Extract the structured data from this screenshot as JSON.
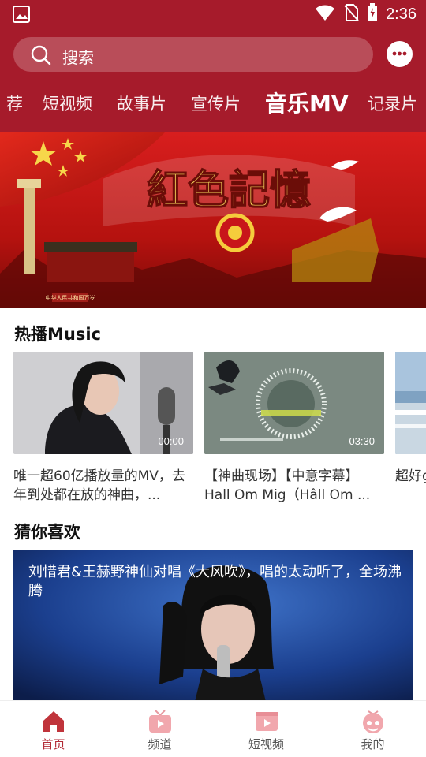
{
  "status_bar": {
    "time": "2:36",
    "icons": [
      "gallery-icon",
      "wifi-icon",
      "no-sim-icon",
      "battery-icon"
    ]
  },
  "header": {
    "search_placeholder": "搜索",
    "chat_icon": "chat-bubble-icon",
    "brand_color": "#a61b2b"
  },
  "tabs": [
    {
      "label": "荐"
    },
    {
      "label": "短视频"
    },
    {
      "label": "故事片"
    },
    {
      "label": "宣传片"
    },
    {
      "label": "音乐MV",
      "active": true
    },
    {
      "label": "记录片"
    }
  ],
  "banner": {
    "title": "紅色記憶",
    "plaque_text": "中华人民共和国万岁"
  },
  "hot_music": {
    "heading": "热播Music",
    "items": [
      {
        "duration": "00:00",
        "title": "唯一超60亿播放量的MV，去年到处都在放的神曲，..."
      },
      {
        "duration": "03:30",
        "title": "【神曲现场】【中意字幕】Hall Om Mig（Hâll Om ..."
      },
      {
        "duration": "",
        "title": "超好girl"
      }
    ]
  },
  "guess_like": {
    "heading": "猜你喜欢",
    "items": [
      {
        "title": "刘惜君&王赫野神仙对唱《大风吹》，唱的太动听了，全场沸腾"
      }
    ]
  },
  "bottom_nav": [
    {
      "label": "首页",
      "icon": "home-icon",
      "active": true
    },
    {
      "label": "频道",
      "icon": "tv-channel-icon"
    },
    {
      "label": "短视频",
      "icon": "video-play-icon"
    },
    {
      "label": "我的",
      "icon": "profile-icon"
    }
  ],
  "colors": {
    "accent": "#a61b2b",
    "active_nav": "#b32a35"
  }
}
